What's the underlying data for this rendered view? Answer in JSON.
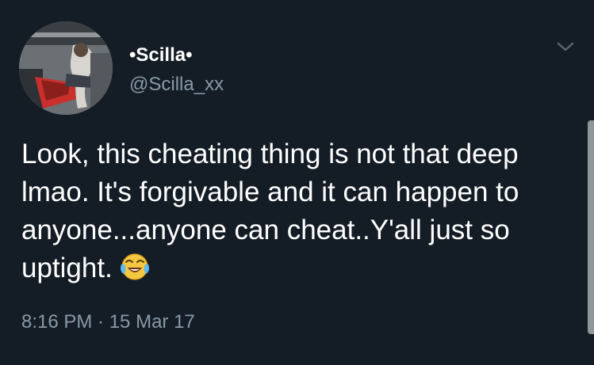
{
  "tweet": {
    "display_name": "•Scilla•",
    "handle": "@Scilla_xx",
    "text": "Look, this cheating thing is not that deep lmao. It's forgivable and it can happen to anyone...anyone can cheat..Y'all just so uptight.",
    "emoji": "face-with-tears-of-joy",
    "timestamp": "8:16 PM · 15 Mar 17"
  },
  "icons": {
    "menu": "chevron-down-icon",
    "emoji": "face-with-tears-of-joy-icon"
  },
  "colors": {
    "background": "#141d26",
    "primary_text": "#ffffff",
    "secondary_text": "#8899a6"
  }
}
